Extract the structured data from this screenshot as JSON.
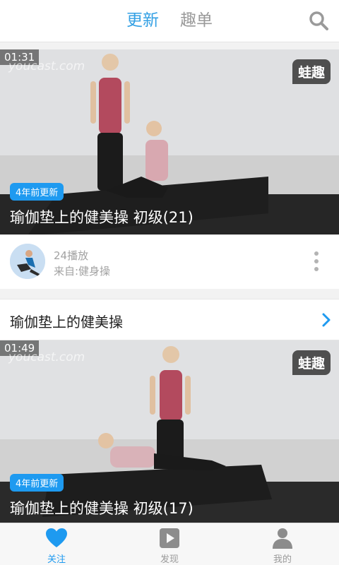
{
  "header": {
    "tabs": [
      {
        "label": "更新",
        "active": true
      },
      {
        "label": "趣单",
        "active": false
      }
    ],
    "search_icon": "search-icon"
  },
  "videos": [
    {
      "duration": "01:31",
      "watermark": "youcast.com",
      "brand": "蛙趣",
      "badge": "4年前更新",
      "title": "瑜伽垫上的健美操 初级(21)"
    },
    {
      "duration": "01:49",
      "watermark": "youcast.com",
      "brand": "蛙趣",
      "badge": "4年前更新",
      "title": "瑜伽垫上的健美操 初级(17)"
    }
  ],
  "author": {
    "plays": "24播放",
    "source": "来自:健身操"
  },
  "series": {
    "title": "瑜伽垫上的健美操"
  },
  "bottom_nav": {
    "items": [
      {
        "label": "关注",
        "icon": "heart-icon",
        "active": true
      },
      {
        "label": "发现",
        "icon": "play-icon",
        "active": false
      },
      {
        "label": "我的",
        "icon": "person-icon",
        "active": false
      }
    ]
  },
  "colors": {
    "accent": "#33a0e4",
    "badge": "#1e9af0",
    "inactive": "#9a9a9a"
  }
}
